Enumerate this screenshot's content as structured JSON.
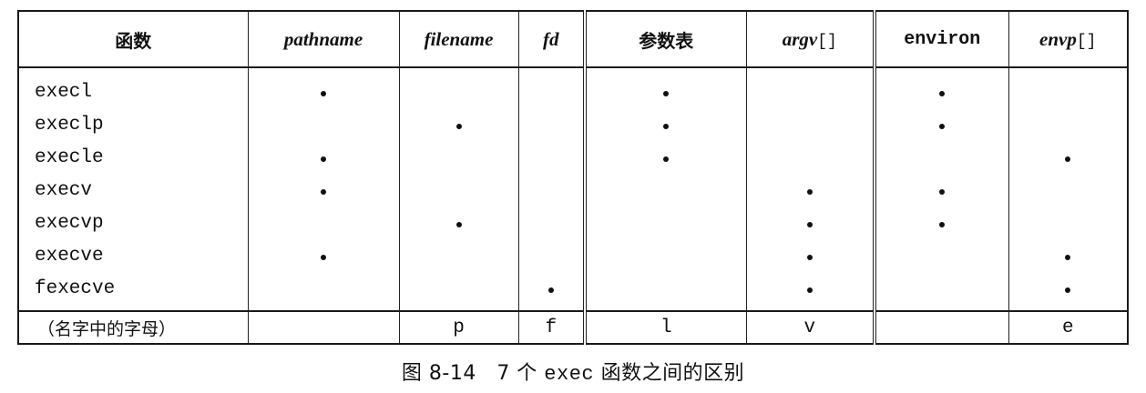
{
  "table": {
    "headers": [
      {
        "text": "函数",
        "style": "cjk"
      },
      {
        "text": "pathname",
        "style": "italic"
      },
      {
        "text": "filename",
        "style": "italic"
      },
      {
        "text": "fd",
        "style": "italic"
      },
      {
        "text": "参数表",
        "style": "cjk"
      },
      {
        "text": "argv",
        "suffix": "[]",
        "style": "italic"
      },
      {
        "text": "environ",
        "style": "mono-bold"
      },
      {
        "text": "envp",
        "suffix": "[]",
        "style": "italic"
      }
    ],
    "rows": [
      {
        "name": "execl",
        "marks": [
          true,
          false,
          false,
          true,
          false,
          true,
          false
        ]
      },
      {
        "name": "execlp",
        "marks": [
          false,
          true,
          false,
          true,
          false,
          true,
          false
        ]
      },
      {
        "name": "execle",
        "marks": [
          true,
          false,
          false,
          true,
          false,
          false,
          true
        ]
      },
      {
        "name": "execv",
        "marks": [
          true,
          false,
          false,
          false,
          true,
          true,
          false
        ]
      },
      {
        "name": "execvp",
        "marks": [
          false,
          true,
          false,
          false,
          true,
          true,
          false
        ]
      },
      {
        "name": "execve",
        "marks": [
          true,
          false,
          false,
          false,
          true,
          false,
          true
        ]
      },
      {
        "name": "fexecve",
        "marks": [
          false,
          false,
          true,
          false,
          true,
          false,
          true
        ]
      }
    ],
    "letters_row": {
      "label": "（名字中的字母）",
      "letters": [
        "",
        "p",
        "f",
        "l",
        "v",
        "",
        "e"
      ]
    }
  },
  "caption": {
    "figure": "图 8-14",
    "text_pre": "7 个 ",
    "text_code": "exec",
    "text_post": " 函数之间的区别"
  }
}
